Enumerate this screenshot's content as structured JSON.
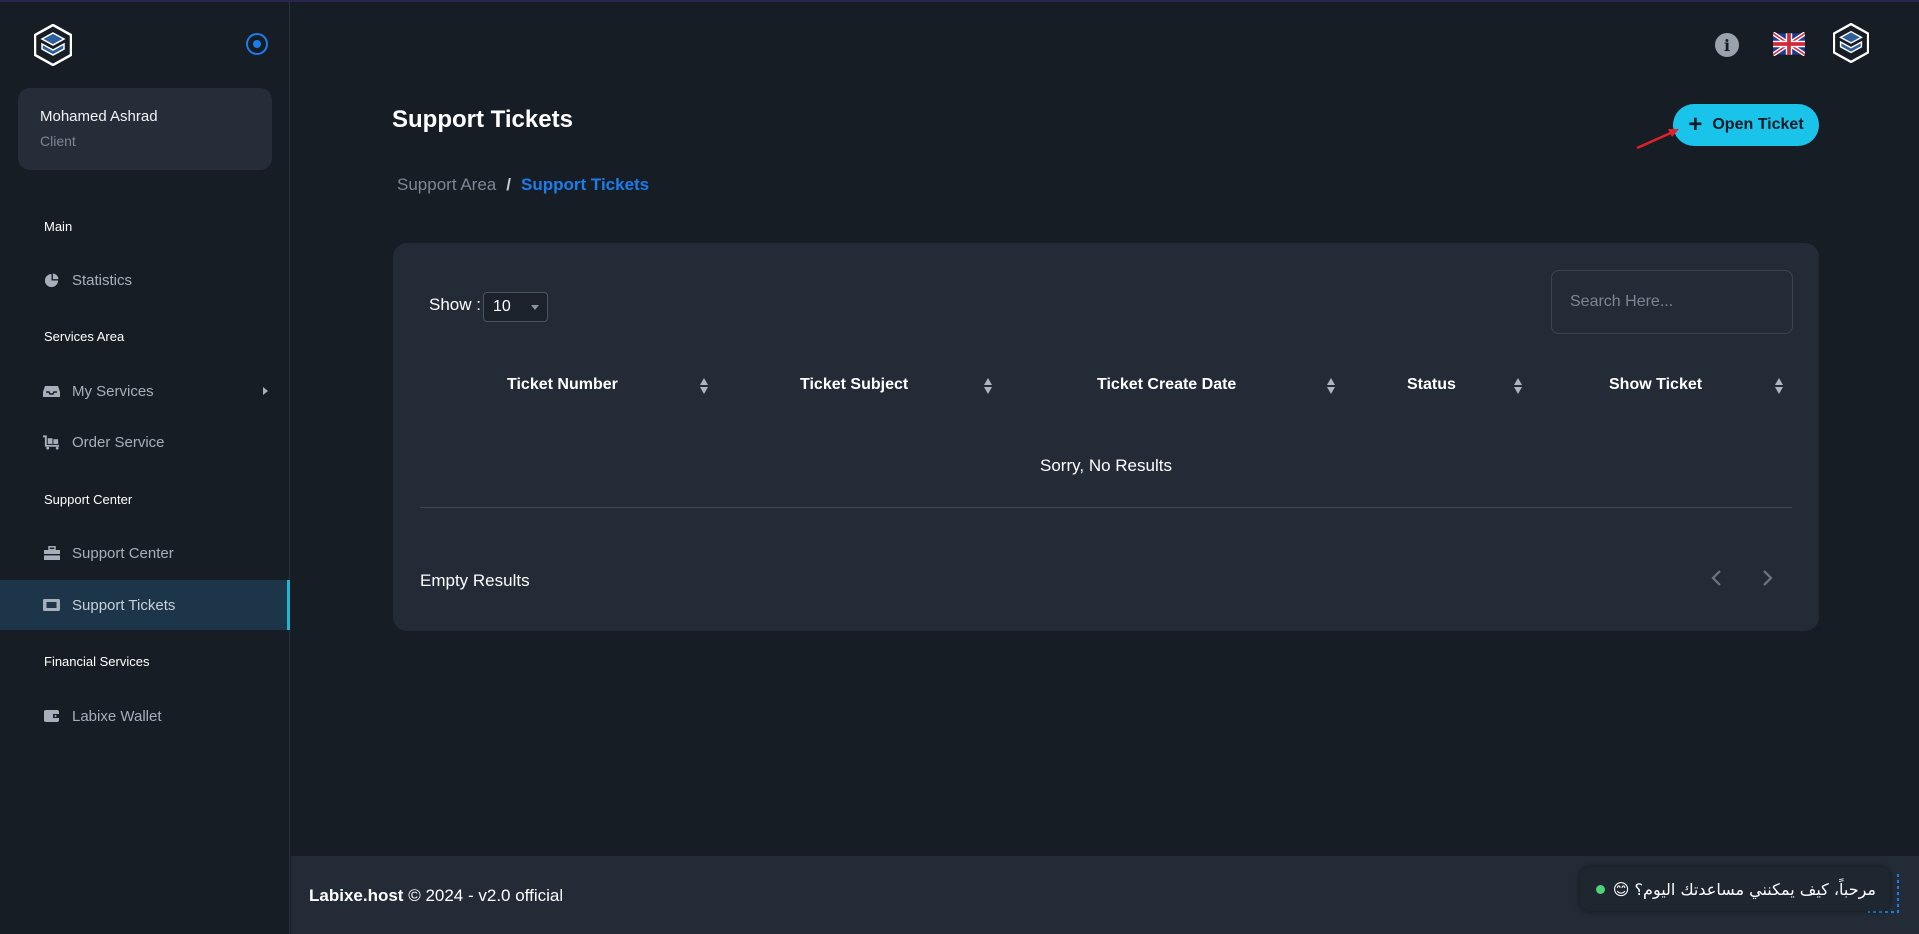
{
  "sidebar": {
    "user": {
      "name": "Mohamed Ashrad",
      "role": "Client"
    },
    "sections": [
      {
        "title": "Main",
        "items": [
          {
            "label": "Statistics",
            "icon": "pie-chart-icon"
          }
        ]
      },
      {
        "title": "Services Area",
        "items": [
          {
            "label": "My Services",
            "icon": "inbox-icon"
          },
          {
            "label": "Order Service",
            "icon": "cart-icon"
          }
        ]
      },
      {
        "title": "Support Center",
        "items": [
          {
            "label": "Support Center",
            "icon": "toolbox-icon"
          },
          {
            "label": "Support Tickets",
            "icon": "ticket-icon",
            "active": true
          }
        ]
      },
      {
        "title": "Financial Services",
        "items": [
          {
            "label": "Labixe Wallet",
            "icon": "wallet-icon"
          }
        ]
      }
    ]
  },
  "header": {
    "title": "Support Tickets",
    "open_ticket_label": "Open Ticket",
    "breadcrumb": {
      "parent": "Support Area",
      "separator": "/",
      "current": "Support Tickets"
    }
  },
  "table": {
    "show_label": "Show :",
    "page_size": "10",
    "search_placeholder": "Search Here...",
    "columns": [
      "Ticket Number",
      "Ticket Subject",
      "Ticket Create Date",
      "Status",
      "Show Ticket"
    ],
    "empty_message": "Sorry, No Results",
    "footer_info": "Empty Results"
  },
  "footer": {
    "brand": "Labixe.host",
    "text": " © 2024 - v2.0 official"
  },
  "chat": {
    "message": "مرحباً، كيف يمكنني مساعدتك اليوم؟ 😊"
  },
  "colors": {
    "accent": "#1ac3ea",
    "link": "#1d7bea",
    "background": "#171d25",
    "card": "#222b36"
  }
}
